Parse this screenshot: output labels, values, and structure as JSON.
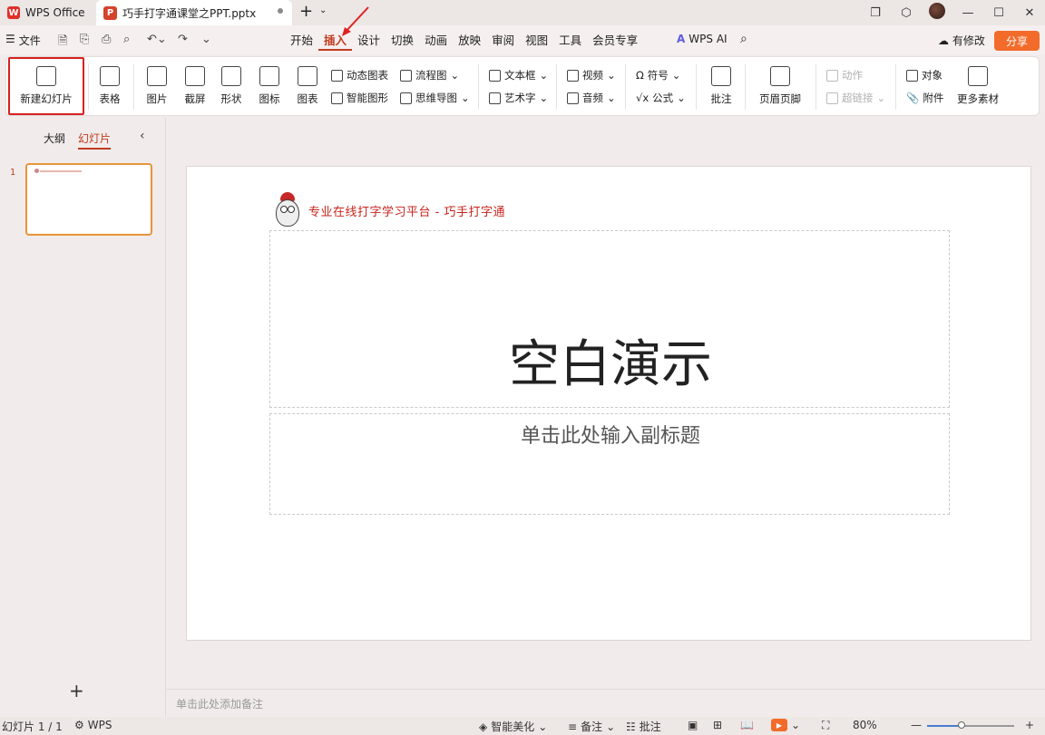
{
  "titlebar": {
    "app_tab": "WPS Office",
    "doc_tab": "巧手打字通课堂之PPT.pptx",
    "add_tab": "+",
    "more": "⌄"
  },
  "menubar": {
    "file": "文件",
    "tabs": [
      "开始",
      "插入",
      "设计",
      "切换",
      "动画",
      "放映",
      "审阅",
      "视图",
      "工具",
      "会员专享"
    ],
    "active_tab": "插入",
    "wps_ai": "WPS AI",
    "changes": "有修改",
    "share": "分享"
  },
  "ribbon": {
    "new_slide": "新建幻灯片",
    "table": "表格",
    "picture": "图片",
    "screenshot": "截屏",
    "shape": "形状",
    "icon": "图标",
    "chart": "图表",
    "dynamic_chart": "动态图表",
    "smart_graphic": "智能图形",
    "flowchart": "流程图",
    "mindmap": "思维导图",
    "textbox": "文本框",
    "wordart": "艺术字",
    "video": "视频",
    "audio": "音频",
    "symbol": "符号",
    "formula": "公式",
    "comment": "批注",
    "header_footer": "页眉页脚",
    "action": "动作",
    "hyperlink": "超链接",
    "object": "对象",
    "attachment": "附件",
    "more_material": "更多素材"
  },
  "leftpanel": {
    "outline_tab": "大纲",
    "slides_tab": "幻灯片",
    "slide_number": "1",
    "add": "+"
  },
  "slide": {
    "brand": "专业在线打字学习平台 - 巧手打字通",
    "title": "空白演示",
    "subtitle": "单击此处输入副标题"
  },
  "notes": {
    "placeholder": "单击此处添加备注"
  },
  "status": {
    "slide_count": "幻灯片 1 / 1",
    "theme": "WPS",
    "beautify": "智能美化",
    "notes": "备注",
    "comments": "批注",
    "zoom": "80%",
    "zoom_level": 0.4
  },
  "colors": {
    "accent": "#c23a1e",
    "share": "#f26b2a",
    "highlight_box": "#d82020"
  }
}
